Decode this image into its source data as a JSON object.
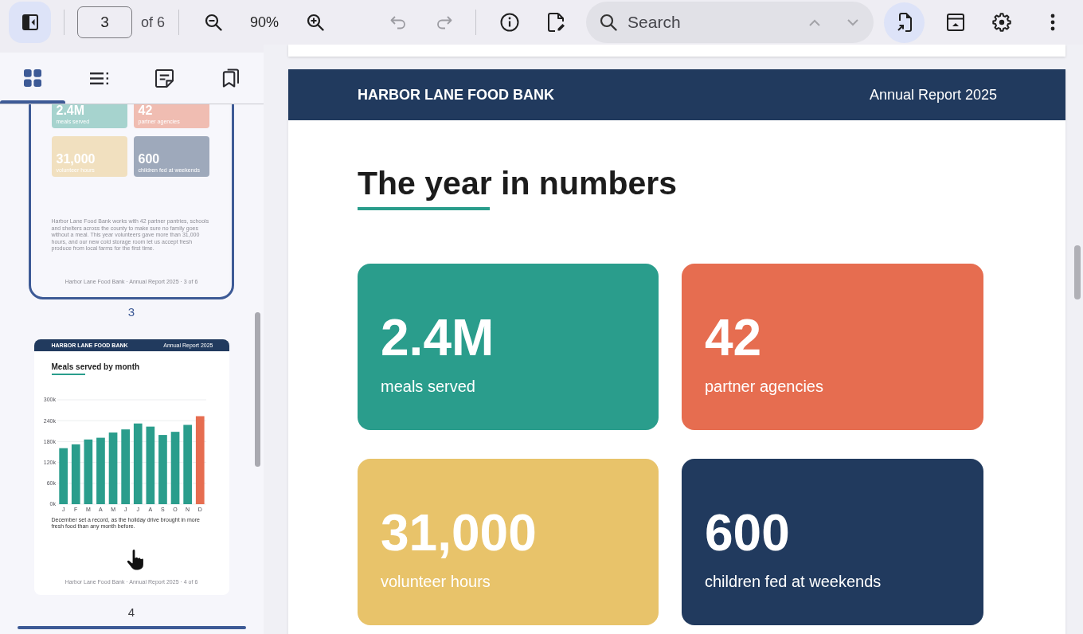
{
  "toolbar": {
    "sidebar_toggle": {
      "on": true
    },
    "page_field": {
      "value": "3"
    },
    "page_total": "of 6",
    "zoom_level": "90%",
    "undo": {
      "disabled": true
    },
    "redo": {
      "disabled": true
    },
    "search": {
      "placeholder": "Search",
      "previous_disabled": true,
      "next_disabled": true
    },
    "present": {
      "on": true
    }
  },
  "sidebar": {
    "tabs": [
      {
        "kind": "thumbnails",
        "selected": true
      },
      {
        "kind": "outline",
        "selected": false
      },
      {
        "kind": "annotations",
        "selected": false
      },
      {
        "kind": "bookmarks",
        "selected": false
      }
    ],
    "thumbnails": [
      {
        "kind": "stats",
        "label": "3",
        "selected": true,
        "stats": [
          {
            "value": "2.4M",
            "label": "meals served",
            "color": "#a6d3ce"
          },
          {
            "value": "42",
            "label": "partner agencies",
            "color": "#f0bdb2"
          },
          {
            "value": "31,000",
            "label": "volunteer hours",
            "color": "#f1e0bf"
          },
          {
            "value": "600",
            "label": "children fed at weekends",
            "color": "#9ea9bb"
          }
        ],
        "body": "Harbor Lane Food Bank works with 42 partner pantries, schools and shelters across the county to make sure no family goes without a meal. This year volunteers gave more than 31,000 hours, and our new cold storage room let us accept fresh produce from local farms for the first time.",
        "footer": "Harbor Lane Food Bank · Annual Report 2025 · 3 of 6"
      },
      {
        "kind": "chart",
        "label": "4",
        "selected": false,
        "header": {
          "organization": "HARBOR LANE FOOD BANK",
          "report": "Annual Report 2025"
        },
        "title": "Meals served by month",
        "chart_data": {
          "type": "bar",
          "categories": [
            "J",
            "F",
            "M",
            "A",
            "M",
            "J",
            "J",
            "A",
            "S",
            "O",
            "N",
            "D"
          ],
          "series": [
            {
              "color": "#2a9d8c",
              "values": [
                161000,
                172000,
                186000,
                191000,
                206000,
                215000,
                232000,
                223000,
                199000,
                208000,
                228000,
                null
              ]
            },
            {
              "color": "#e66d50",
              "values": [
                null,
                null,
                null,
                null,
                null,
                null,
                null,
                null,
                null,
                null,
                null,
                253000
              ]
            }
          ],
          "ylim": [
            0,
            300000
          ],
          "yticks": [
            {
              "value": 0,
              "label": "0k"
            },
            {
              "value": 60000,
              "label": "60k"
            },
            {
              "value": 120000,
              "label": "120k"
            },
            {
              "value": 180000,
              "label": "180k"
            },
            {
              "value": 240000,
              "label": "240k"
            },
            {
              "value": 300000,
              "label": "300k"
            }
          ],
          "grid": true
        },
        "caption": "December set a record, as the holiday drive brought in more fresh food than any month before.",
        "footer": "Harbor Lane Food Bank · Annual Report 2025 · 4 of 6"
      }
    ]
  },
  "page": {
    "header": {
      "organization": "HARBOR LANE FOOD BANK",
      "report": "Annual Report 2025"
    },
    "title": "The year in numbers",
    "stats": [
      {
        "value": "2.4M",
        "label": "meals served",
        "color": "#2a9d8c"
      },
      {
        "value": "42",
        "label": "partner agencies",
        "color": "#e66d50"
      },
      {
        "value": "31,000",
        "label": "volunteer hours",
        "color": "#e8c36a"
      },
      {
        "value": "600",
        "label": "children fed at weekends",
        "color": "#213a5e"
      }
    ]
  }
}
